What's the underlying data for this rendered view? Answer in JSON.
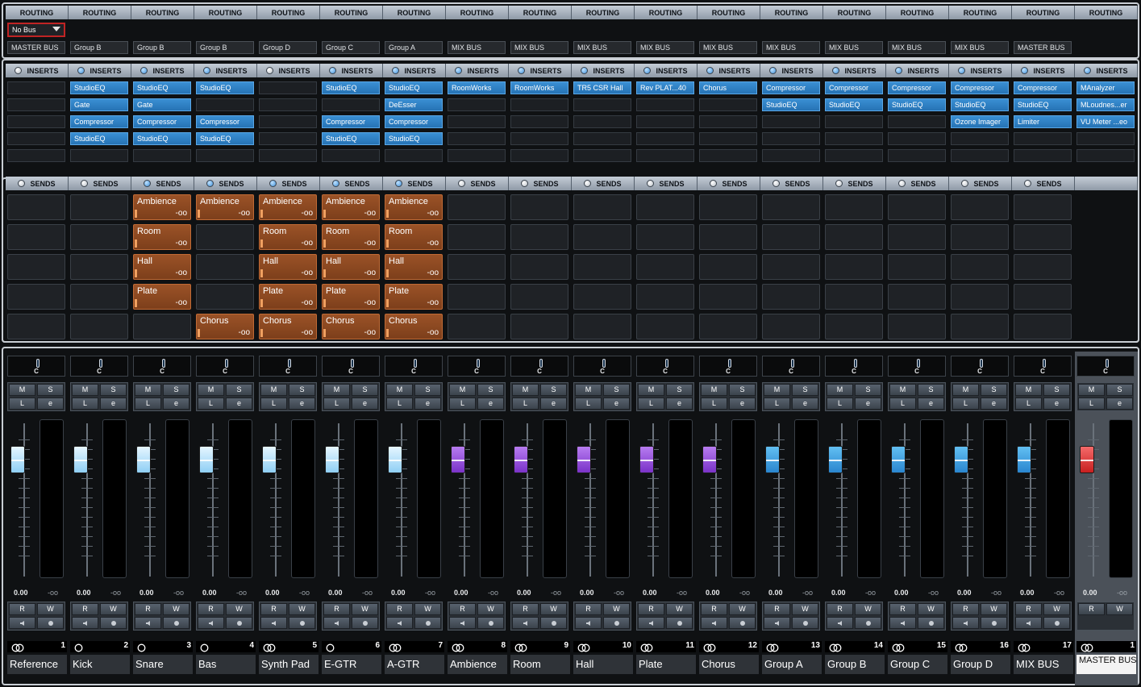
{
  "sections": {
    "routing_label": "ROUTING",
    "inserts_label": "INSERTS",
    "sends_label": "SENDS"
  },
  "labels": {
    "pan": "C",
    "mute": "M",
    "solo": "S",
    "listen": "L",
    "edit": "e",
    "read": "R",
    "write": "W",
    "level": "0.00",
    "peak": "-oo"
  },
  "colors": {
    "fader_lightblue": "#bfe6ff",
    "fader_purple": "#9b4fe0",
    "fader_blue": "#3aa0e8",
    "fader_red": "#e23b3b",
    "send_active": "#8c4a22",
    "insert_plugin": "#2f82c6"
  },
  "channels": [
    {
      "name": "Reference",
      "number": "1",
      "input": "No Bus",
      "output": "MASTER BUS",
      "link": "stereo",
      "inserts_on": false,
      "inserts": [
        "",
        "",
        "",
        "",
        ""
      ],
      "sends_on": false,
      "sends": [
        {
          "name": "",
          "value": ""
        },
        {
          "name": "",
          "value": ""
        },
        {
          "name": "",
          "value": ""
        },
        {
          "name": "",
          "value": ""
        },
        {
          "name": "",
          "value": ""
        }
      ],
      "fader": "lightblue"
    },
    {
      "name": "Kick",
      "number": "2",
      "input": "",
      "output": "Group B",
      "link": "mono",
      "inserts_on": true,
      "inserts": [
        "StudioEQ",
        "Gate",
        "Compressor",
        "StudioEQ",
        ""
      ],
      "sends_on": false,
      "sends": [
        {
          "name": "",
          "value": ""
        },
        {
          "name": "",
          "value": ""
        },
        {
          "name": "",
          "value": ""
        },
        {
          "name": "",
          "value": ""
        },
        {
          "name": "",
          "value": ""
        }
      ],
      "fader": "lightblue"
    },
    {
      "name": "Snare",
      "number": "3",
      "input": "",
      "output": "Group B",
      "link": "mono",
      "inserts_on": true,
      "inserts": [
        "StudioEQ",
        "Gate",
        "Compressor",
        "StudioEQ",
        ""
      ],
      "sends_on": true,
      "sends": [
        {
          "name": "Ambience",
          "value": "-oo"
        },
        {
          "name": "Room",
          "value": "-oo"
        },
        {
          "name": "Hall",
          "value": "-oo"
        },
        {
          "name": "Plate",
          "value": "-oo"
        },
        {
          "name": "",
          "value": ""
        }
      ],
      "fader": "lightblue"
    },
    {
      "name": "Bas",
      "number": "4",
      "input": "",
      "output": "Group B",
      "link": "mono",
      "inserts_on": true,
      "inserts": [
        "StudioEQ",
        "",
        "Compressor",
        "StudioEQ",
        ""
      ],
      "sends_on": true,
      "sends": [
        {
          "name": "Ambience",
          "value": "-oo"
        },
        {
          "name": "",
          "value": ""
        },
        {
          "name": "",
          "value": ""
        },
        {
          "name": "",
          "value": ""
        },
        {
          "name": "Chorus",
          "value": "-oo"
        }
      ],
      "fader": "lightblue"
    },
    {
      "name": "Synth Pad",
      "number": "5",
      "input": "",
      "output": "Group D",
      "link": "stereo",
      "inserts_on": false,
      "inserts": [
        "",
        "",
        "",
        "",
        ""
      ],
      "sends_on": true,
      "sends": [
        {
          "name": "Ambience",
          "value": "-oo"
        },
        {
          "name": "Room",
          "value": "-oo"
        },
        {
          "name": "Hall",
          "value": "-oo"
        },
        {
          "name": "Plate",
          "value": "-oo"
        },
        {
          "name": "Chorus",
          "value": "-oo"
        }
      ],
      "fader": "lightblue"
    },
    {
      "name": "E-GTR",
      "number": "6",
      "input": "",
      "output": "Group C",
      "link": "mono",
      "inserts_on": true,
      "inserts": [
        "StudioEQ",
        "",
        "Compressor",
        "StudioEQ",
        ""
      ],
      "sends_on": true,
      "sends": [
        {
          "name": "Ambience",
          "value": "-oo"
        },
        {
          "name": "Room",
          "value": "-oo"
        },
        {
          "name": "Hall",
          "value": "-oo"
        },
        {
          "name": "Plate",
          "value": "-oo"
        },
        {
          "name": "Chorus",
          "value": "-oo"
        }
      ],
      "fader": "lightblue"
    },
    {
      "name": "A-GTR",
      "number": "7",
      "input": "",
      "output": "Group A",
      "link": "stereo",
      "inserts_on": true,
      "inserts": [
        "StudioEQ",
        "DeEsser",
        "Compressor",
        "StudioEQ",
        ""
      ],
      "sends_on": true,
      "sends": [
        {
          "name": "Ambience",
          "value": "-oo"
        },
        {
          "name": "Room",
          "value": "-oo"
        },
        {
          "name": "Hall",
          "value": "-oo"
        },
        {
          "name": "Plate",
          "value": "-oo"
        },
        {
          "name": "Chorus",
          "value": "-oo"
        }
      ],
      "fader": "lightblue"
    },
    {
      "name": "Ambience",
      "number": "8",
      "input": "",
      "output": "MIX BUS",
      "link": "stereo",
      "inserts_on": true,
      "inserts": [
        "RoomWorks",
        "",
        "",
        "",
        ""
      ],
      "sends_on": false,
      "sends": [
        {
          "name": "",
          "value": ""
        },
        {
          "name": "",
          "value": ""
        },
        {
          "name": "",
          "value": ""
        },
        {
          "name": "",
          "value": ""
        },
        {
          "name": "",
          "value": ""
        }
      ],
      "fader": "purple"
    },
    {
      "name": "Room",
      "number": "9",
      "input": "",
      "output": "MIX BUS",
      "link": "stereo",
      "inserts_on": true,
      "inserts": [
        "RoomWorks",
        "",
        "",
        "",
        ""
      ],
      "sends_on": false,
      "sends": [
        {
          "name": "",
          "value": ""
        },
        {
          "name": "",
          "value": ""
        },
        {
          "name": "",
          "value": ""
        },
        {
          "name": "",
          "value": ""
        },
        {
          "name": "",
          "value": ""
        }
      ],
      "fader": "purple"
    },
    {
      "name": "Hall",
      "number": "10",
      "input": "",
      "output": "MIX BUS",
      "link": "stereo",
      "inserts_on": true,
      "inserts": [
        "TR5 CSR Hall",
        "",
        "",
        "",
        ""
      ],
      "sends_on": false,
      "sends": [
        {
          "name": "",
          "value": ""
        },
        {
          "name": "",
          "value": ""
        },
        {
          "name": "",
          "value": ""
        },
        {
          "name": "",
          "value": ""
        },
        {
          "name": "",
          "value": ""
        }
      ],
      "fader": "purple"
    },
    {
      "name": "Plate",
      "number": "11",
      "input": "",
      "output": "MIX BUS",
      "link": "stereo",
      "inserts_on": true,
      "inserts": [
        "Rev PLAT...40",
        "",
        "",
        "",
        ""
      ],
      "sends_on": false,
      "sends": [
        {
          "name": "",
          "value": ""
        },
        {
          "name": "",
          "value": ""
        },
        {
          "name": "",
          "value": ""
        },
        {
          "name": "",
          "value": ""
        },
        {
          "name": "",
          "value": ""
        }
      ],
      "fader": "purple"
    },
    {
      "name": "Chorus",
      "number": "12",
      "input": "",
      "output": "MIX BUS",
      "link": "stereo",
      "inserts_on": true,
      "inserts": [
        "Chorus",
        "",
        "",
        "",
        ""
      ],
      "sends_on": false,
      "sends": [
        {
          "name": "",
          "value": ""
        },
        {
          "name": "",
          "value": ""
        },
        {
          "name": "",
          "value": ""
        },
        {
          "name": "",
          "value": ""
        },
        {
          "name": "",
          "value": ""
        }
      ],
      "fader": "purple"
    },
    {
      "name": "Group A",
      "number": "13",
      "input": "",
      "output": "MIX BUS",
      "link": "stereo",
      "inserts_on": true,
      "inserts": [
        "Compressor",
        "StudioEQ",
        "",
        "",
        ""
      ],
      "sends_on": false,
      "sends": [
        {
          "name": "",
          "value": ""
        },
        {
          "name": "",
          "value": ""
        },
        {
          "name": "",
          "value": ""
        },
        {
          "name": "",
          "value": ""
        },
        {
          "name": "",
          "value": ""
        }
      ],
      "fader": "blue"
    },
    {
      "name": "Group B",
      "number": "14",
      "input": "",
      "output": "MIX BUS",
      "link": "stereo",
      "inserts_on": true,
      "inserts": [
        "Compressor",
        "StudioEQ",
        "",
        "",
        ""
      ],
      "sends_on": false,
      "sends": [
        {
          "name": "",
          "value": ""
        },
        {
          "name": "",
          "value": ""
        },
        {
          "name": "",
          "value": ""
        },
        {
          "name": "",
          "value": ""
        },
        {
          "name": "",
          "value": ""
        }
      ],
      "fader": "blue"
    },
    {
      "name": "Group C",
      "number": "15",
      "input": "",
      "output": "MIX BUS",
      "link": "stereo",
      "inserts_on": true,
      "inserts": [
        "Compressor",
        "StudioEQ",
        "",
        "",
        ""
      ],
      "sends_on": false,
      "sends": [
        {
          "name": "",
          "value": ""
        },
        {
          "name": "",
          "value": ""
        },
        {
          "name": "",
          "value": ""
        },
        {
          "name": "",
          "value": ""
        },
        {
          "name": "",
          "value": ""
        }
      ],
      "fader": "blue"
    },
    {
      "name": "Group D",
      "number": "16",
      "input": "",
      "output": "MIX BUS",
      "link": "stereo",
      "inserts_on": true,
      "inserts": [
        "Compressor",
        "StudioEQ",
        "Ozone Imager",
        "",
        ""
      ],
      "sends_on": false,
      "sends": [
        {
          "name": "",
          "value": ""
        },
        {
          "name": "",
          "value": ""
        },
        {
          "name": "",
          "value": ""
        },
        {
          "name": "",
          "value": ""
        },
        {
          "name": "",
          "value": ""
        }
      ],
      "fader": "blue"
    },
    {
      "name": "MIX BUS",
      "number": "17",
      "input": "",
      "output": "MASTER BUS",
      "link": "stereo",
      "inserts_on": true,
      "inserts": [
        "Compressor",
        "StudioEQ",
        "Limiter",
        "",
        ""
      ],
      "sends_on": false,
      "sends": [
        {
          "name": "",
          "value": ""
        },
        {
          "name": "",
          "value": ""
        },
        {
          "name": "",
          "value": ""
        },
        {
          "name": "",
          "value": ""
        },
        {
          "name": "",
          "value": ""
        }
      ],
      "fader": "blue"
    },
    {
      "name": "MASTER BUS",
      "number": "1",
      "input": "",
      "output": "",
      "link": "stereo",
      "inserts_on": true,
      "inserts": [
        "MAnalyzer",
        "MLoudnes...er",
        "VU Meter ...eo",
        "",
        ""
      ],
      "sends_on": null,
      "sends": [],
      "fader": "red",
      "master": true
    }
  ]
}
